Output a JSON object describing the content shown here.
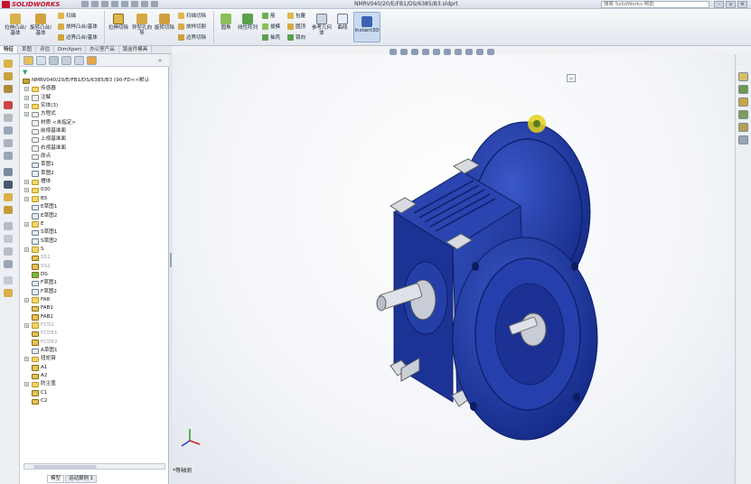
{
  "app": {
    "logo_text": "SOLIDWORKS",
    "doc_title": "NMRV040/20/E/FB1/DS/6385/B3.sldprt",
    "search_placeholder": "搜索 SolidWorks 帮助"
  },
  "window_controls": [
    "–",
    "▫",
    "✕"
  ],
  "ribbon": {
    "large_buttons": [
      {
        "label": "拉伸凸台/基体",
        "icon": "boss-extrude-icon"
      },
      {
        "label": "旋转凸台/基体",
        "icon": "revolve-boss-icon"
      },
      {
        "label": "拉伸切除",
        "icon": "cut-extrude-icon"
      },
      {
        "label": "异型孔向导",
        "icon": "hole-wizard-icon"
      },
      {
        "label": "旋转切除",
        "icon": "revolve-cut-icon"
      },
      {
        "label": "圆角",
        "icon": "fillet-icon"
      },
      {
        "label": "线性阵列",
        "icon": "linear-pattern-icon"
      },
      {
        "label": "参考几何体",
        "icon": "reference-geometry-icon"
      },
      {
        "label": "曲线",
        "icon": "curves-icon"
      },
      {
        "label": "Instant3D",
        "icon": "instant3d-icon"
      }
    ],
    "small_buttons": [
      {
        "label": "扫描",
        "icon": "sweep-icon"
      },
      {
        "label": "放样凸台/基体",
        "icon": "loft-icon"
      },
      {
        "label": "边界凸台/基体",
        "icon": "boundary-boss-icon"
      },
      {
        "label": "扫描切除",
        "icon": "swept-cut-icon"
      },
      {
        "label": "放样切割",
        "icon": "lofted-cut-icon"
      },
      {
        "label": "边界切除",
        "icon": "boundary-cut-icon"
      },
      {
        "label": "筋",
        "icon": "rib-icon"
      },
      {
        "label": "拔模",
        "icon": "draft-icon"
      },
      {
        "label": "抽壳",
        "icon": "shell-icon"
      },
      {
        "label": "包覆",
        "icon": "wrap-icon"
      },
      {
        "label": "圆顶",
        "icon": "dome-icon"
      },
      {
        "label": "镜向",
        "icon": "mirror-icon"
      }
    ]
  },
  "command_tabs": [
    {
      "label": "特征",
      "active": true
    },
    {
      "label": "草图",
      "active": false
    },
    {
      "label": "评估",
      "active": false
    },
    {
      "label": "DimXpert",
      "active": false
    },
    {
      "label": "办公室产品",
      "active": false
    },
    {
      "label": "钣金件模具",
      "active": false
    }
  ],
  "feature_tree": {
    "root": "NMRV040/20/E/FB1/DS/6385/B3 (90-FD<<默认",
    "nodes": [
      {
        "label": "传感器",
        "icon": "folder",
        "exp": true
      },
      {
        "label": "注解",
        "icon": "annotation",
        "exp": true
      },
      {
        "label": "实体(3)",
        "icon": "folder",
        "exp": true
      },
      {
        "label": "方程式",
        "icon": "equation",
        "exp": true
      },
      {
        "label": "材质 <未指定>",
        "icon": "material",
        "exp": false
      },
      {
        "label": "前视基准面",
        "icon": "plane",
        "exp": false
      },
      {
        "label": "上视基准面",
        "icon": "plane",
        "exp": false
      },
      {
        "label": "右视基准面",
        "icon": "plane",
        "exp": false
      },
      {
        "label": "原点",
        "icon": "origin",
        "exp": false
      },
      {
        "label": "草图1",
        "icon": "sketch",
        "exp": false
      },
      {
        "label": "草图2",
        "icon": "sketch",
        "exp": false
      },
      {
        "label": "槽体",
        "icon": "folder",
        "exp": true
      },
      {
        "label": "030",
        "icon": "folder",
        "exp": true
      },
      {
        "label": "B5",
        "icon": "folder",
        "exp": true
      },
      {
        "label": "E草图1",
        "icon": "sketch",
        "exp": false
      },
      {
        "label": "E草图2",
        "icon": "sketch",
        "exp": false
      },
      {
        "label": "E",
        "icon": "folder",
        "exp": true
      },
      {
        "label": "S草图1",
        "icon": "sketch",
        "exp": false
      },
      {
        "label": "S草图2",
        "icon": "sketch",
        "exp": false
      },
      {
        "label": "S",
        "icon": "folder",
        "exp": true
      },
      {
        "label": "SS1",
        "icon": "feature",
        "exp": false,
        "sup": true
      },
      {
        "label": "SS2",
        "icon": "feature",
        "exp": false,
        "sup": true
      },
      {
        "label": "DS",
        "icon": "feature-green",
        "exp": false
      },
      {
        "label": "F草图1",
        "icon": "sketch",
        "exp": false
      },
      {
        "label": "F草图2",
        "icon": "sketch",
        "exp": false
      },
      {
        "label": "FA8",
        "icon": "folder",
        "exp": true
      },
      {
        "label": "FAB1",
        "icon": "feature",
        "exp": false
      },
      {
        "label": "FAB2",
        "icon": "feature",
        "exp": false
      },
      {
        "label": "FCD2",
        "icon": "folder",
        "exp": true,
        "sup": true
      },
      {
        "label": "FCDE1",
        "icon": "feature",
        "exp": false,
        "sup": true
      },
      {
        "label": "FCDE2",
        "icon": "feature",
        "exp": false,
        "sup": true
      },
      {
        "label": "A草图1",
        "icon": "sketch",
        "exp": false
      },
      {
        "label": "扭矩臂",
        "icon": "folder",
        "exp": true
      },
      {
        "label": "A1",
        "icon": "feature",
        "exp": false
      },
      {
        "label": "A2",
        "icon": "feature",
        "exp": false
      },
      {
        "label": "防尘盖",
        "icon": "folder",
        "exp": true
      },
      {
        "label": "C1",
        "icon": "feature",
        "exp": false
      },
      {
        "label": "C2",
        "icon": "feature",
        "exp": false
      }
    ]
  },
  "bottom_tabs": [
    {
      "label": "模型",
      "active": true
    },
    {
      "label": "运动算例 1",
      "active": false
    }
  ],
  "viewport": {
    "view_label": "*等轴测",
    "model": "worm-gearbox-model"
  },
  "colors": {
    "accent": "#1e3a9a",
    "bg": "#f1f2f4",
    "body_blue": "#2036a0"
  }
}
